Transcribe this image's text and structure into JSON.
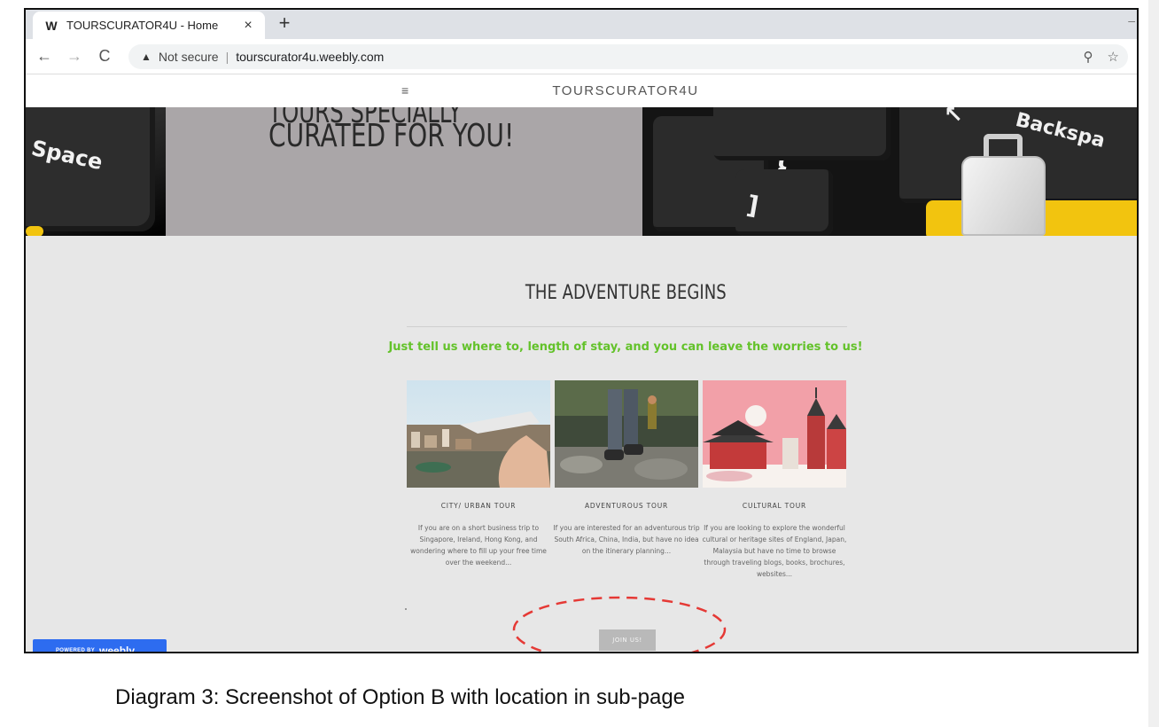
{
  "browser": {
    "tab_title": "TOURSCURATOR4U - Home",
    "tab_favicon": "weebly-w-icon",
    "tab_close": "×",
    "new_tab": "+",
    "security_label": "Not secure",
    "url": "tourscurator4u.weebly.com",
    "nav": {
      "back": "←",
      "forward": "→",
      "reload": "C"
    },
    "zoom_icon": "⚲",
    "bookmark_icon": "☆"
  },
  "site": {
    "menu_icon": "≡",
    "name": "TOURSCURATOR4U",
    "hero": {
      "title_line1": "TOURS SPECIALLY",
      "title_line2": "CURATED FOR YOU!",
      "key_left_label": "Space",
      "key_right_label": "Backspa",
      "key_brace1": "}",
      "key_brace2": "]"
    },
    "section_title": "THE ADVENTURE BEGINS",
    "tagline": "Just tell us where to, length of stay, and you can leave the worries to us!",
    "cards": [
      {
        "heading": "CITY/ URBAN TOUR",
        "text": "If you are on a short business trip to Singapore, Ireland, Hong Kong, and wondering where to fill up your free time over the weekend..."
      },
      {
        "heading": "ADVENTUROUS TOUR",
        "text": "If you are interested for an adventurous trip South Africa, China, India, but have no idea on the itinerary planning..."
      },
      {
        "heading": "CULTURAL TOUR",
        "text": "If you are looking to explore the wonderful cultural or heritage sites of England, Japan, Malaysia but have no time to browse through traveling blogs, books, brochures, websites..."
      }
    ],
    "join_button": "JOIN US!",
    "badge": {
      "powered": "POWERED BY",
      "brand": "weebly"
    }
  },
  "caption": "Diagram 3: Screenshot of Option B with location in sub-page",
  "colors": {
    "tagline_green": "#63c22a",
    "weebly_blue": "#2d6cf0",
    "annotation_red": "#e53935",
    "join_button_grey": "#b9b9b9"
  }
}
